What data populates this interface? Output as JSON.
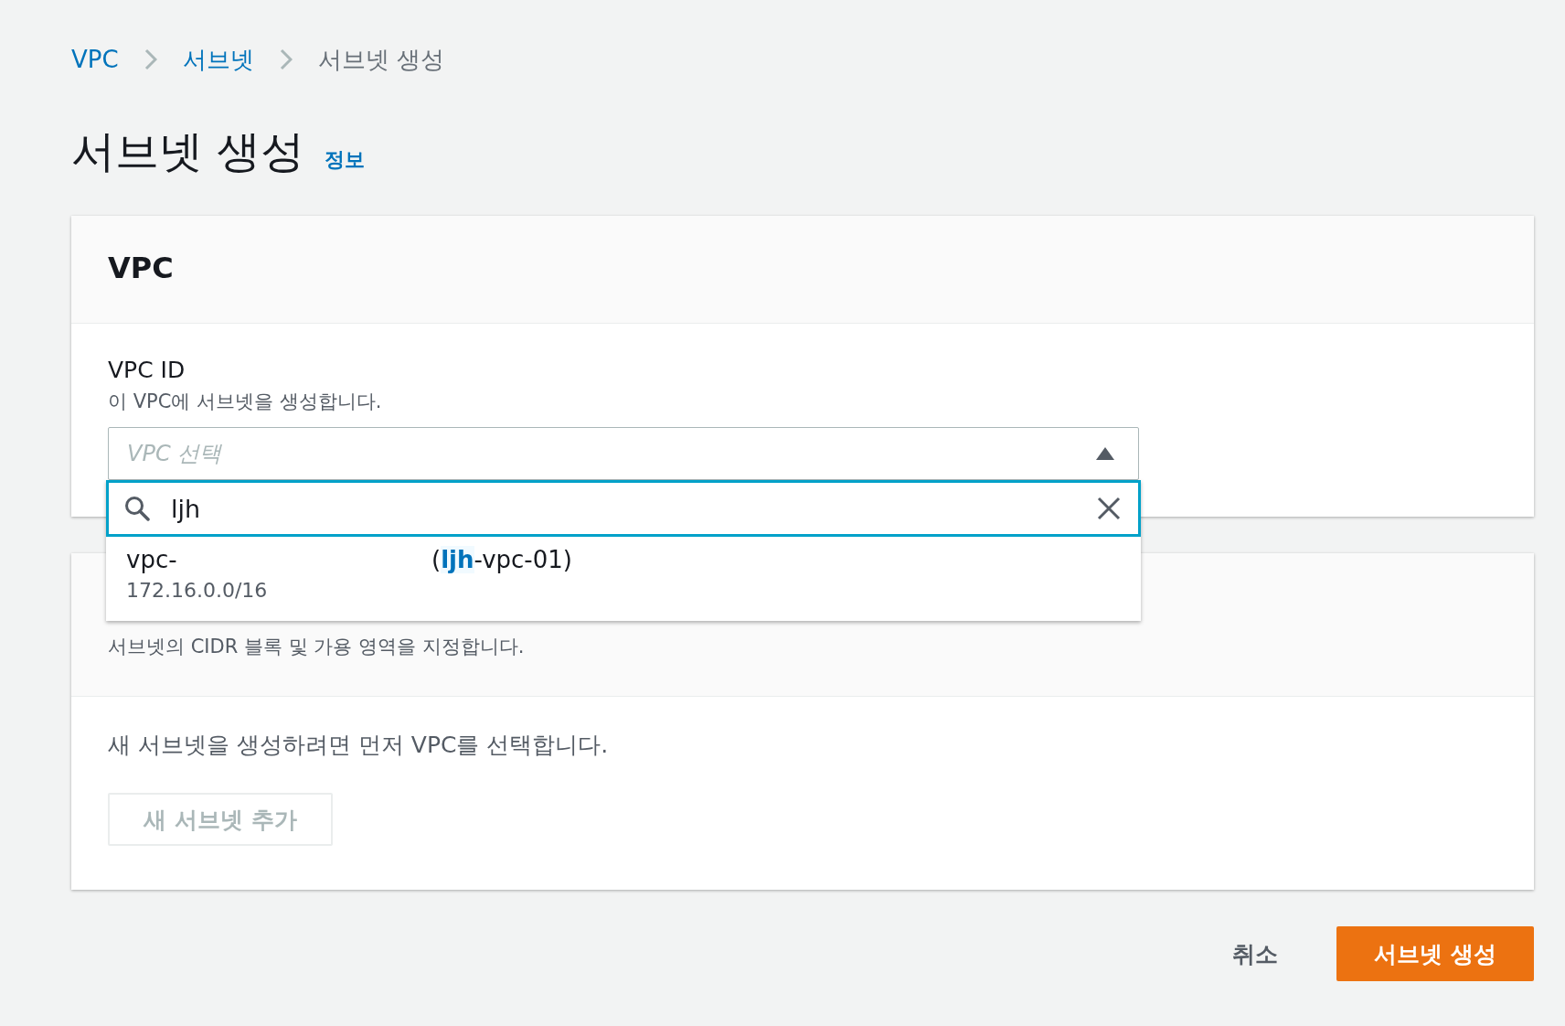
{
  "breadcrumbs": [
    {
      "label": "VPC",
      "link": true
    },
    {
      "label": "서브넷",
      "link": true
    },
    {
      "label": "서브넷 생성",
      "link": false
    }
  ],
  "page": {
    "title": "서브넷 생성",
    "info": "정보"
  },
  "vpc_card": {
    "title": "VPC",
    "field_label": "VPC ID",
    "field_description": "이 VPC에 서브넷을 생성합니다.",
    "select_placeholder": "VPC 선택",
    "expanded": true,
    "search": {
      "value": "ljh"
    },
    "options": [
      {
        "id": "vpc-",
        "before": "(",
        "match": "ljh",
        "after": "-vpc-01)",
        "cidr": "172.16.0.0/16"
      }
    ]
  },
  "subnet_card": {
    "description": "서브넷의 CIDR 블록 및 가용 영역을 지정합니다.",
    "empty_text": "새 서브넷을 생성하려면 먼저 VPC를 선택합니다.",
    "add_button": {
      "label": "새 서브넷 추가",
      "disabled": true
    }
  },
  "footer": {
    "cancel": "취소",
    "submit": "서브넷 생성"
  }
}
